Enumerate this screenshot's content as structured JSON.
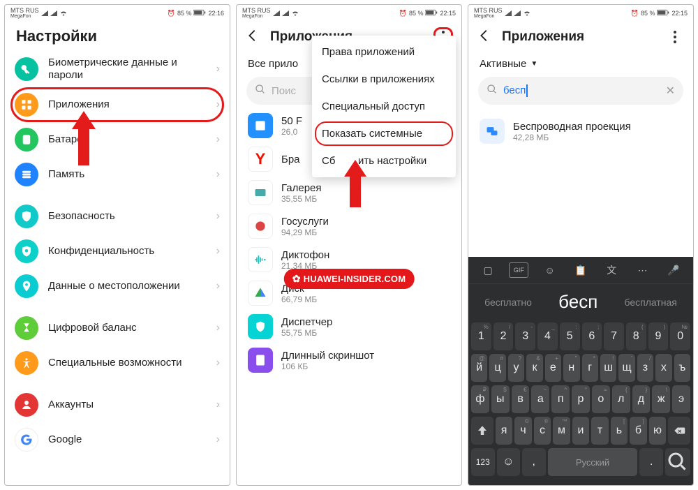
{
  "statusbar": {
    "carrier": "MTS RUS",
    "carrier2": "MegaFon",
    "battery_pct": "85 %",
    "time1": "22:16",
    "time2": "22:15",
    "time3": "22:15"
  },
  "screen1": {
    "title": "Настройки",
    "items": [
      {
        "label": "Биометрические данные и пароли",
        "icon": "key-icon",
        "color": "ic-teal"
      },
      {
        "label": "Приложения",
        "icon": "apps-icon",
        "color": "ic-orange",
        "highlighted": true
      },
      {
        "label": "Батарея",
        "icon": "battery-icon",
        "color": "ic-green"
      },
      {
        "label": "Память",
        "icon": "storage-icon",
        "color": "ic-blue"
      },
      {
        "label": "Безопасность",
        "icon": "security-icon",
        "color": "ic-sec"
      },
      {
        "label": "Конфиденциальность",
        "icon": "privacy-icon",
        "color": "ic-priv"
      },
      {
        "label": "Данные о местоположении",
        "icon": "location-icon",
        "color": "ic-loc"
      },
      {
        "label": "Цифровой баланс",
        "icon": "balance-icon",
        "color": "ic-bal"
      },
      {
        "label": "Специальные возможности",
        "icon": "accessibility-icon",
        "color": "ic-acc"
      },
      {
        "label": "Аккаунты",
        "icon": "account-icon",
        "color": "ic-user"
      },
      {
        "label": "Google",
        "icon": "google-icon",
        "color": "ic-google"
      }
    ]
  },
  "screen2": {
    "title": "Приложения",
    "subtitle": "Все прило",
    "search_placeholder": "Поис",
    "popup": [
      {
        "label": "Права приложений"
      },
      {
        "label": "Ссылки в приложениях"
      },
      {
        "label": "Специальный доступ"
      },
      {
        "label": "Показать системные",
        "hl": true
      },
      {
        "label": "Сбросить настройки"
      }
    ],
    "apps": [
      {
        "name": "50 F",
        "size": "26,0",
        "color": "fill-blue"
      },
      {
        "name": "Бра",
        "size": "",
        "color": "fill-white",
        "letter": "Y",
        "letterColor": "#e10"
      },
      {
        "name": "Галерея",
        "size": "35,55 МБ",
        "color": "fill-white"
      },
      {
        "name": "Госуслуги",
        "size": "94,29 МБ",
        "color": "fill-white"
      },
      {
        "name": "Диктофон",
        "size": "21,34 МБ",
        "color": "fill-wave"
      },
      {
        "name": "Диск",
        "size": "66,79 МБ",
        "color": "fill-white"
      },
      {
        "name": "Диспетчер",
        "size": "55,75 МБ",
        "color": "fill-teal"
      },
      {
        "name": "Длинный скриншот",
        "size": "106 КБ",
        "color": "fill-purple"
      }
    ],
    "watermark": "HUAWEI-INSIDER.COM"
  },
  "screen3": {
    "title": "Приложения",
    "filter": "Активные",
    "search_value": "бесп",
    "result": {
      "name": "Беспроводная проекция",
      "size": "42,28 МБ"
    },
    "keyboard": {
      "suggest_left": "бесплатно",
      "suggest_main": "бесп",
      "suggest_right": "бесплатная",
      "row_num": [
        "1",
        "2",
        "3",
        "4",
        "5",
        "6",
        "7",
        "8",
        "9",
        "0"
      ],
      "row_num_sup": [
        "%",
        "/",
        "-",
        "_",
        ":",
        ";",
        "",
        "(",
        ")",
        "№"
      ],
      "row1": [
        "й",
        "ц",
        "у",
        "к",
        "е",
        "н",
        "г",
        "ш",
        "щ",
        "з",
        "х",
        "ъ"
      ],
      "row1_sup": [
        "@",
        "#",
        "?",
        "&",
        "+",
        "\"",
        "*",
        "!",
        "'",
        "/",
        "",
        ""
      ],
      "row2": [
        "ф",
        "ы",
        "в",
        "а",
        "п",
        "р",
        "о",
        "л",
        "д",
        "ж",
        "э"
      ],
      "row2_sup": [
        "₽",
        "$",
        "€",
        "~",
        "^",
        "°",
        "=",
        "{",
        "}",
        "\\",
        ""
      ],
      "row3": [
        "я",
        "ч",
        "с",
        "м",
        "и",
        "т",
        "ь",
        "б",
        "ю"
      ],
      "row3_sup": [
        "",
        "©",
        "®",
        "™",
        "",
        "",
        "[",
        "]",
        ""
      ],
      "func_123": "123",
      "func_lang": "Русский",
      "func_comma": ",",
      "func_dot": "."
    }
  }
}
